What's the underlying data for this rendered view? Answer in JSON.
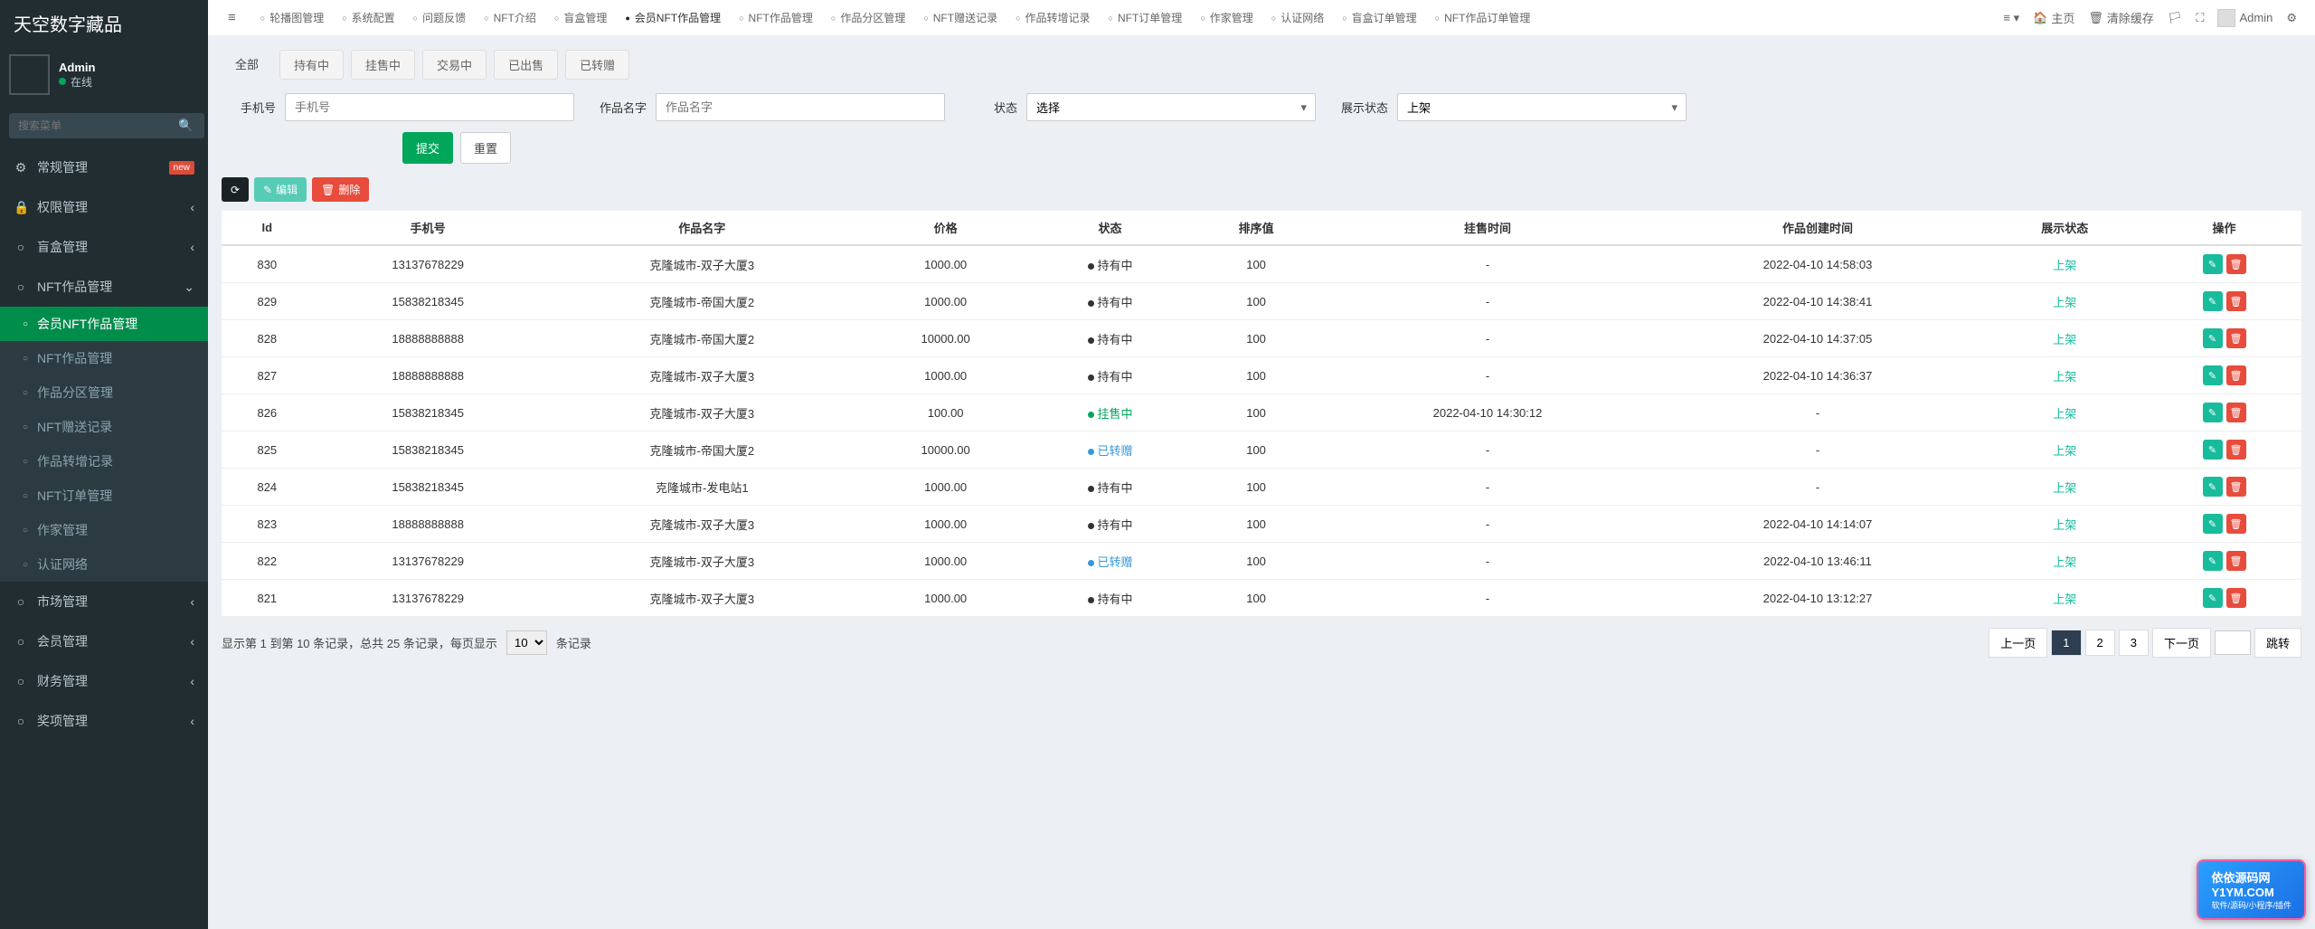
{
  "brand": "天空数字藏品",
  "user": {
    "name": "Admin",
    "status": "在线"
  },
  "search_placeholder": "搜索菜单",
  "sidebar": {
    "items": [
      {
        "label": "常规管理",
        "icon": "⚙",
        "badge": "new"
      },
      {
        "label": "权限管理",
        "icon": "🔒",
        "children": true
      },
      {
        "label": "盲盒管理",
        "icon": "○",
        "children": true
      },
      {
        "label": "NFT作品管理",
        "icon": "○",
        "children": true,
        "open": true,
        "sub": [
          {
            "label": "会员NFT作品管理",
            "active": true
          },
          {
            "label": "NFT作品管理"
          },
          {
            "label": "作品分区管理"
          },
          {
            "label": "NFT赠送记录"
          },
          {
            "label": "作品转增记录"
          },
          {
            "label": "NFT订单管理"
          },
          {
            "label": "作家管理"
          },
          {
            "label": "认证网络"
          }
        ]
      },
      {
        "label": "市场管理",
        "icon": "○",
        "children": true
      },
      {
        "label": "会员管理",
        "icon": "○",
        "children": true
      },
      {
        "label": "财务管理",
        "icon": "○",
        "children": true
      },
      {
        "label": "奖项管理",
        "icon": "○",
        "children": true
      }
    ]
  },
  "top_tabs": [
    "轮播图管理",
    "系统配置",
    "问题反馈",
    "NFT介绍",
    "盲盒管理",
    "会员NFT作品管理",
    "NFT作品管理",
    "作品分区管理",
    "NFT赠送记录",
    "作品转增记录",
    "NFT订单管理",
    "作家管理",
    "认证网络",
    "盲盒订单管理",
    "NFT作品订单管理"
  ],
  "top_active_index": 5,
  "topbar_right": {
    "home": "主页",
    "clear": "清除缓存",
    "user": "Admin"
  },
  "filter_tabs": [
    "全部",
    "持有中",
    "挂售中",
    "交易中",
    "已出售",
    "已转赠"
  ],
  "filter_selected": 0,
  "filters": {
    "phone": {
      "label": "手机号",
      "placeholder": "手机号"
    },
    "name": {
      "label": "作品名字",
      "placeholder": "作品名字"
    },
    "status": {
      "label": "状态",
      "value": "选择"
    },
    "display": {
      "label": "展示状态",
      "value": "上架"
    }
  },
  "buttons": {
    "submit": "提交",
    "reset": "重置",
    "edit": "编辑",
    "delete": "删除"
  },
  "table": {
    "headers": [
      "Id",
      "手机号",
      "作品名字",
      "价格",
      "状态",
      "排序值",
      "挂售时间",
      "作品创建时间",
      "展示状态",
      "操作"
    ],
    "rows": [
      {
        "id": "830",
        "phone": "13137678229",
        "name": "克隆城市-双子大厦3",
        "price": "1000.00",
        "status": "持有中",
        "status_class": "held",
        "sort": "100",
        "sale_time": "-",
        "create_time": "2022-04-10 14:58:03",
        "display": "上架"
      },
      {
        "id": "829",
        "phone": "15838218345",
        "name": "克隆城市-帝国大厦2",
        "price": "1000.00",
        "status": "持有中",
        "status_class": "held",
        "sort": "100",
        "sale_time": "-",
        "create_time": "2022-04-10 14:38:41",
        "display": "上架"
      },
      {
        "id": "828",
        "phone": "18888888888",
        "name": "克隆城市-帝国大厦2",
        "price": "10000.00",
        "status": "持有中",
        "status_class": "held",
        "sort": "100",
        "sale_time": "-",
        "create_time": "2022-04-10 14:37:05",
        "display": "上架"
      },
      {
        "id": "827",
        "phone": "18888888888",
        "name": "克隆城市-双子大厦3",
        "price": "1000.00",
        "status": "持有中",
        "status_class": "held",
        "sort": "100",
        "sale_time": "-",
        "create_time": "2022-04-10 14:36:37",
        "display": "上架"
      },
      {
        "id": "826",
        "phone": "15838218345",
        "name": "克隆城市-双子大厦3",
        "price": "100.00",
        "status": "挂售中",
        "status_class": "sale",
        "sort": "100",
        "sale_time": "2022-04-10 14:30:12",
        "create_time": "-",
        "display": "上架"
      },
      {
        "id": "825",
        "phone": "15838218345",
        "name": "克隆城市-帝国大厦2",
        "price": "10000.00",
        "status": "已转赠",
        "status_class": "gift",
        "sort": "100",
        "sale_time": "-",
        "create_time": "-",
        "display": "上架"
      },
      {
        "id": "824",
        "phone": "15838218345",
        "name": "克隆城市-发电站1",
        "price": "1000.00",
        "status": "持有中",
        "status_class": "held",
        "sort": "100",
        "sale_time": "-",
        "create_time": "-",
        "display": "上架"
      },
      {
        "id": "823",
        "phone": "18888888888",
        "name": "克隆城市-双子大厦3",
        "price": "1000.00",
        "status": "持有中",
        "status_class": "held",
        "sort": "100",
        "sale_time": "-",
        "create_time": "2022-04-10 14:14:07",
        "display": "上架"
      },
      {
        "id": "822",
        "phone": "13137678229",
        "name": "克隆城市-双子大厦3",
        "price": "1000.00",
        "status": "已转赠",
        "status_class": "gift",
        "sort": "100",
        "sale_time": "-",
        "create_time": "2022-04-10 13:46:11",
        "display": "上架"
      },
      {
        "id": "821",
        "phone": "13137678229",
        "name": "克隆城市-双子大厦3",
        "price": "1000.00",
        "status": "持有中",
        "status_class": "held",
        "sort": "100",
        "sale_time": "-",
        "create_time": "2022-04-10 13:12:27",
        "display": "上架"
      }
    ]
  },
  "pagination": {
    "info_prefix": "显示第 1 到第 10 条记录，总共 25 条记录，每页显示",
    "info_suffix": "条记录",
    "page_size": "10",
    "prev": "上一页",
    "next": "下一页",
    "jump": "跳转",
    "pages": [
      "1",
      "2",
      "3"
    ],
    "current": 0
  },
  "watermark": {
    "title": "依依源码网",
    "domain": "Y1YM.COM",
    "sub": "软件/源码/小程序/插件"
  }
}
